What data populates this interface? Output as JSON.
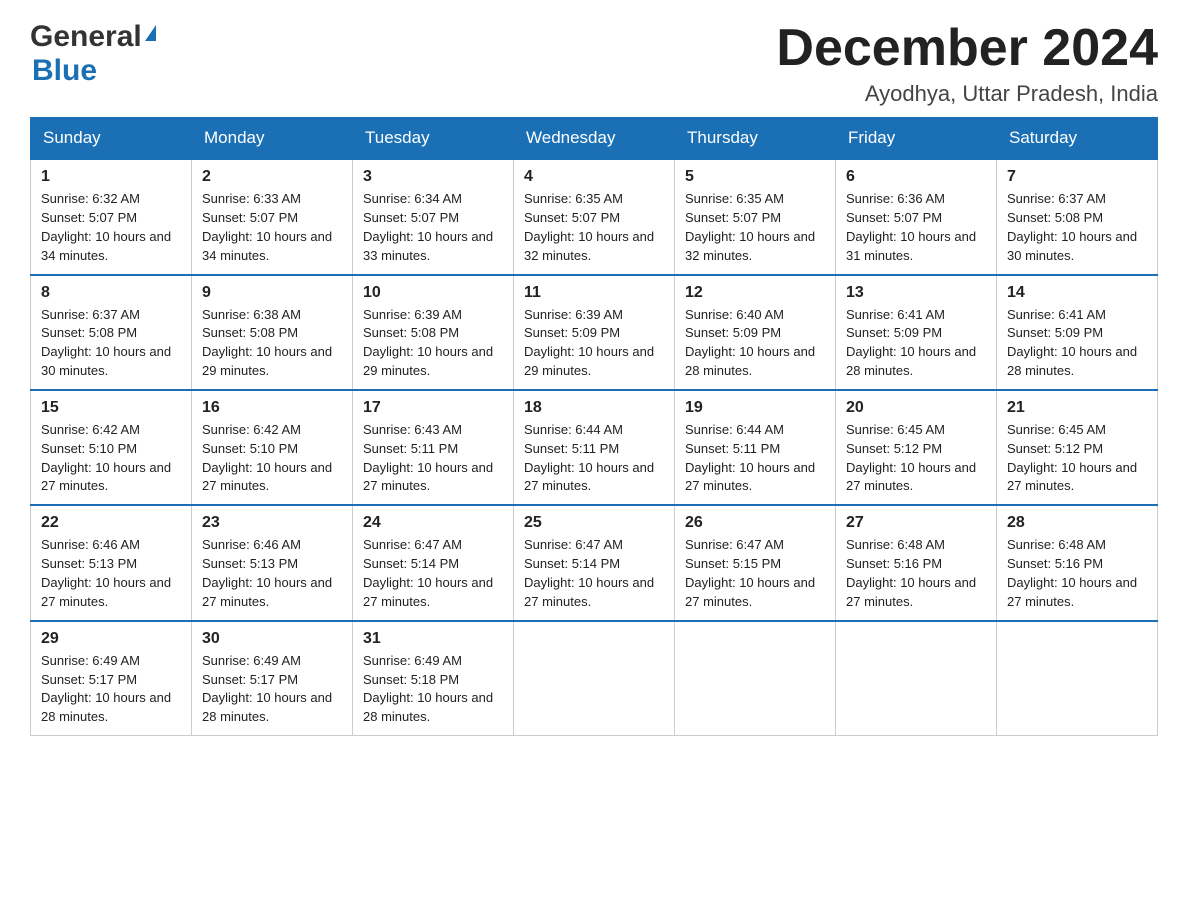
{
  "header": {
    "logo_general": "General",
    "logo_blue": "Blue",
    "month_year": "December 2024",
    "location": "Ayodhya, Uttar Pradesh, India"
  },
  "days_of_week": [
    "Sunday",
    "Monday",
    "Tuesday",
    "Wednesday",
    "Thursday",
    "Friday",
    "Saturday"
  ],
  "weeks": [
    [
      {
        "day": "1",
        "sunrise": "6:32 AM",
        "sunset": "5:07 PM",
        "daylight": "10 hours and 34 minutes."
      },
      {
        "day": "2",
        "sunrise": "6:33 AM",
        "sunset": "5:07 PM",
        "daylight": "10 hours and 34 minutes."
      },
      {
        "day": "3",
        "sunrise": "6:34 AM",
        "sunset": "5:07 PM",
        "daylight": "10 hours and 33 minutes."
      },
      {
        "day": "4",
        "sunrise": "6:35 AM",
        "sunset": "5:07 PM",
        "daylight": "10 hours and 32 minutes."
      },
      {
        "day": "5",
        "sunrise": "6:35 AM",
        "sunset": "5:07 PM",
        "daylight": "10 hours and 32 minutes."
      },
      {
        "day": "6",
        "sunrise": "6:36 AM",
        "sunset": "5:07 PM",
        "daylight": "10 hours and 31 minutes."
      },
      {
        "day": "7",
        "sunrise": "6:37 AM",
        "sunset": "5:08 PM",
        "daylight": "10 hours and 30 minutes."
      }
    ],
    [
      {
        "day": "8",
        "sunrise": "6:37 AM",
        "sunset": "5:08 PM",
        "daylight": "10 hours and 30 minutes."
      },
      {
        "day": "9",
        "sunrise": "6:38 AM",
        "sunset": "5:08 PM",
        "daylight": "10 hours and 29 minutes."
      },
      {
        "day": "10",
        "sunrise": "6:39 AM",
        "sunset": "5:08 PM",
        "daylight": "10 hours and 29 minutes."
      },
      {
        "day": "11",
        "sunrise": "6:39 AM",
        "sunset": "5:09 PM",
        "daylight": "10 hours and 29 minutes."
      },
      {
        "day": "12",
        "sunrise": "6:40 AM",
        "sunset": "5:09 PM",
        "daylight": "10 hours and 28 minutes."
      },
      {
        "day": "13",
        "sunrise": "6:41 AM",
        "sunset": "5:09 PM",
        "daylight": "10 hours and 28 minutes."
      },
      {
        "day": "14",
        "sunrise": "6:41 AM",
        "sunset": "5:09 PM",
        "daylight": "10 hours and 28 minutes."
      }
    ],
    [
      {
        "day": "15",
        "sunrise": "6:42 AM",
        "sunset": "5:10 PM",
        "daylight": "10 hours and 27 minutes."
      },
      {
        "day": "16",
        "sunrise": "6:42 AM",
        "sunset": "5:10 PM",
        "daylight": "10 hours and 27 minutes."
      },
      {
        "day": "17",
        "sunrise": "6:43 AM",
        "sunset": "5:11 PM",
        "daylight": "10 hours and 27 minutes."
      },
      {
        "day": "18",
        "sunrise": "6:44 AM",
        "sunset": "5:11 PM",
        "daylight": "10 hours and 27 minutes."
      },
      {
        "day": "19",
        "sunrise": "6:44 AM",
        "sunset": "5:11 PM",
        "daylight": "10 hours and 27 minutes."
      },
      {
        "day": "20",
        "sunrise": "6:45 AM",
        "sunset": "5:12 PM",
        "daylight": "10 hours and 27 minutes."
      },
      {
        "day": "21",
        "sunrise": "6:45 AM",
        "sunset": "5:12 PM",
        "daylight": "10 hours and 27 minutes."
      }
    ],
    [
      {
        "day": "22",
        "sunrise": "6:46 AM",
        "sunset": "5:13 PM",
        "daylight": "10 hours and 27 minutes."
      },
      {
        "day": "23",
        "sunrise": "6:46 AM",
        "sunset": "5:13 PM",
        "daylight": "10 hours and 27 minutes."
      },
      {
        "day": "24",
        "sunrise": "6:47 AM",
        "sunset": "5:14 PM",
        "daylight": "10 hours and 27 minutes."
      },
      {
        "day": "25",
        "sunrise": "6:47 AM",
        "sunset": "5:14 PM",
        "daylight": "10 hours and 27 minutes."
      },
      {
        "day": "26",
        "sunrise": "6:47 AM",
        "sunset": "5:15 PM",
        "daylight": "10 hours and 27 minutes."
      },
      {
        "day": "27",
        "sunrise": "6:48 AM",
        "sunset": "5:16 PM",
        "daylight": "10 hours and 27 minutes."
      },
      {
        "day": "28",
        "sunrise": "6:48 AM",
        "sunset": "5:16 PM",
        "daylight": "10 hours and 27 minutes."
      }
    ],
    [
      {
        "day": "29",
        "sunrise": "6:49 AM",
        "sunset": "5:17 PM",
        "daylight": "10 hours and 28 minutes."
      },
      {
        "day": "30",
        "sunrise": "6:49 AM",
        "sunset": "5:17 PM",
        "daylight": "10 hours and 28 minutes."
      },
      {
        "day": "31",
        "sunrise": "6:49 AM",
        "sunset": "5:18 PM",
        "daylight": "10 hours and 28 minutes."
      },
      null,
      null,
      null,
      null
    ]
  ]
}
